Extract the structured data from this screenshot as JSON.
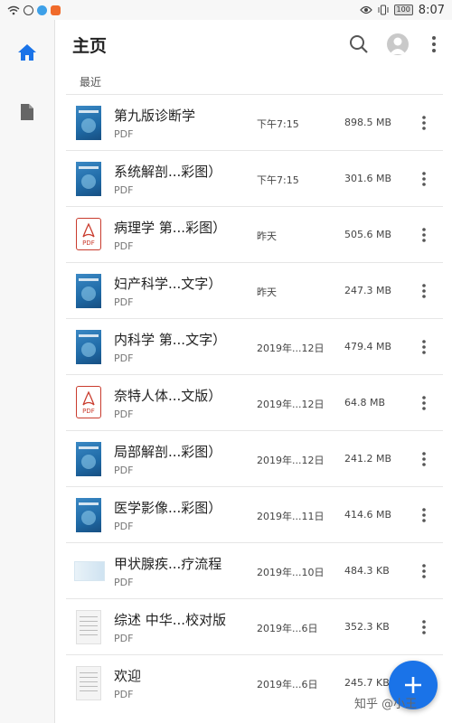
{
  "status_bar": {
    "time": "8:07",
    "battery": "100"
  },
  "sidebar": {
    "items": [
      {
        "icon": "home-icon"
      },
      {
        "icon": "document-icon"
      }
    ]
  },
  "header": {
    "title": "主页"
  },
  "section": {
    "label": "最近"
  },
  "files": [
    {
      "name": "第九版诊断学",
      "type": "PDF",
      "date": "下午7:15",
      "size": "898.5 MB",
      "thumb": "book"
    },
    {
      "name": "系统解剖...彩图）",
      "type": "PDF",
      "date": "下午7:15",
      "size": "301.6 MB",
      "thumb": "book"
    },
    {
      "name": "病理学 第...彩图）",
      "type": "PDF",
      "date": "昨天",
      "size": "505.6 MB",
      "thumb": "pdf"
    },
    {
      "name": "妇产科学...文字）",
      "type": "PDF",
      "date": "昨天",
      "size": "247.3 MB",
      "thumb": "book"
    },
    {
      "name": "内科学 第...文字）",
      "type": "PDF",
      "date": "2019年...12日",
      "size": "479.4 MB",
      "thumb": "book"
    },
    {
      "name": "奈特人体...文版）",
      "type": "PDF",
      "date": "2019年...12日",
      "size": "64.8 MB",
      "thumb": "pdf"
    },
    {
      "name": "局部解剖...彩图）",
      "type": "PDF",
      "date": "2019年...12日",
      "size": "241.2 MB",
      "thumb": "book"
    },
    {
      "name": "医学影像...彩图）",
      "type": "PDF",
      "date": "2019年...11日",
      "size": "414.6 MB",
      "thumb": "book"
    },
    {
      "name": "甲状腺疾...疗流程",
      "type": "PDF",
      "date": "2019年...10日",
      "size": "484.3 KB",
      "thumb": "wide"
    },
    {
      "name": "综述 中华...校对版",
      "type": "PDF",
      "date": "2019年...6日",
      "size": "352.3 KB",
      "thumb": "doc"
    },
    {
      "name": "欢迎",
      "type": "PDF",
      "date": "2019年...6日",
      "size": "245.7 KB",
      "thumb": "doc"
    }
  ],
  "pdf_badge": "PDF",
  "watermark": "知乎 @小王",
  "colors": {
    "accent": "#1a73e8",
    "pdf_red": "#c93b2d",
    "book_blue": "#1f6aa6"
  }
}
